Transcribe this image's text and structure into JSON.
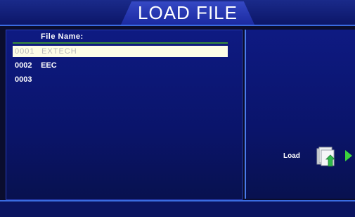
{
  "window": {
    "title": "LOAD FILE"
  },
  "file_list": {
    "column_header": "File Name:",
    "rows": [
      {
        "number": "0001",
        "name": "EXTECH",
        "selected": true
      },
      {
        "number": "0002",
        "name": "EEC",
        "selected": false
      },
      {
        "number": "0003",
        "name": "",
        "selected": false
      }
    ]
  },
  "actions": {
    "load_label": "Load",
    "load_icon": "folder-load-icon",
    "arrow_icon": "play-arrow-icon"
  },
  "colors": {
    "background": "#0a0d2e",
    "panel": "#0e1a82",
    "accent": "#3a6be0",
    "selection": "#fdfde6",
    "arrow": "#3cd23c"
  }
}
